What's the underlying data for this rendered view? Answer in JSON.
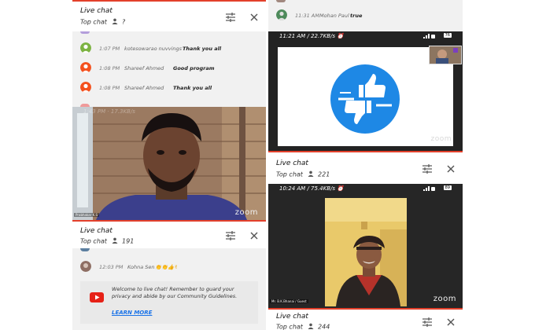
{
  "left": {
    "chat1": {
      "title": "Live chat",
      "top_chat": "Top chat",
      "viewers": "?",
      "messages": [
        {
          "time": "1:07 PM",
          "author": "kotesowarao nuvvings",
          "text": "Thank you all",
          "avatar_color": "#7cb342"
        },
        {
          "time": "1:08 PM",
          "author": "Shareef Ahmed",
          "text": "Good program",
          "avatar_color": "#f4511e"
        },
        {
          "time": "1:08 PM",
          "author": "Shareef Ahmed",
          "text": "Thank you all",
          "avatar_color": "#f4511e"
        }
      ]
    },
    "video1": {
      "status_text": "1:43 PM · 17.3KB/s",
      "name_tag": "Prabhakar K.S",
      "watermark": "zoom"
    },
    "chat2": {
      "title": "Live chat",
      "top_chat": "Top chat",
      "viewers": "191",
      "messages": [
        {
          "time": "12:03 PM",
          "author": "Kohna Sen",
          "text": "👏👏👍✌",
          "avatar_color": "#8e6e63"
        }
      ],
      "welcome_text": "Welcome to live chat! Remember to guard your privacy and abide by our Community Guidelines.",
      "learn_more": "LEARN MORE"
    }
  },
  "right": {
    "top_message": {
      "time": "11:31 AM",
      "author": "Mohan Paul",
      "text": "true",
      "avatar_color": "#4e8a5b"
    },
    "video2": {
      "status_text": "11:21 AM / 22.7KB/s ⏰",
      "battery": "76",
      "watermark": "zoom"
    },
    "chat3": {
      "title": "Live chat",
      "top_chat": "Top chat",
      "viewers": "221"
    },
    "video3": {
      "status_text": "10:24 AM / 75.4KB/s ⏰",
      "battery": "89",
      "name_tag": "Mr. B.K.Bhanai / Guest",
      "watermark": "zoom"
    },
    "chat4": {
      "title": "Live chat",
      "top_chat": "Top chat",
      "viewers": "244"
    }
  },
  "colors": {
    "accent": "#e3402b",
    "link": "#1a73e8",
    "app_logo": "#1e88e5",
    "youtube": "#e62117"
  },
  "icons": [
    "tune-icon",
    "close-icon",
    "person-icon",
    "thumbs-icon",
    "youtube-icon"
  ]
}
